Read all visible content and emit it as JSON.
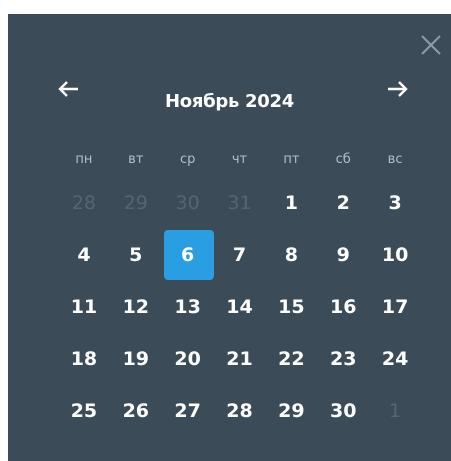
{
  "calendar": {
    "title": "Ноябрь 2024",
    "weekdays": [
      "пн",
      "вт",
      "ср",
      "чт",
      "пт",
      "сб",
      "вс"
    ],
    "weeks": [
      [
        "28",
        "29",
        "30",
        "31",
        "1",
        "2",
        "3"
      ],
      [
        "4",
        "5",
        "6",
        "7",
        "8",
        "9",
        "10"
      ],
      [
        "11",
        "12",
        "13",
        "14",
        "15",
        "16",
        "17"
      ],
      [
        "18",
        "19",
        "20",
        "21",
        "22",
        "23",
        "24"
      ],
      [
        "25",
        "26",
        "27",
        "28",
        "29",
        "30",
        "1"
      ]
    ],
    "selected_day": "6",
    "colors": {
      "panel": "#3b4c58",
      "accent": "#2a9ee2",
      "muted": "#56656f",
      "weekday": "#b3bec6"
    }
  },
  "icons": {
    "close": "close-icon",
    "prev": "arrow-left-icon",
    "next": "arrow-right-icon"
  }
}
